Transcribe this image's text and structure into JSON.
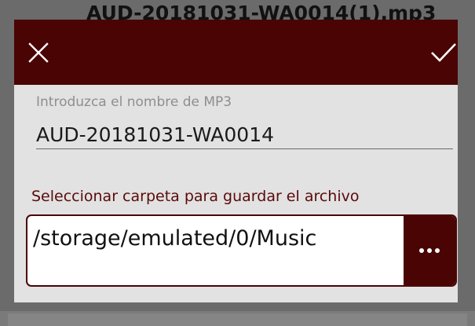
{
  "background": {
    "title": "AUD-20181031-WA0014(1).mp3"
  },
  "dialog": {
    "accent_color": "#4a0404",
    "close_icon": "close-icon",
    "confirm_icon": "checkmark-icon",
    "name_field": {
      "label": "Introduzca el nombre de MP3",
      "value": "AUD-20181031-WA0014"
    },
    "folder": {
      "label": "Seleccionar carpeta para guardar el archivo",
      "path": "/storage/emulated/0/Music",
      "browse_icon": "more-horizontal-icon"
    }
  }
}
